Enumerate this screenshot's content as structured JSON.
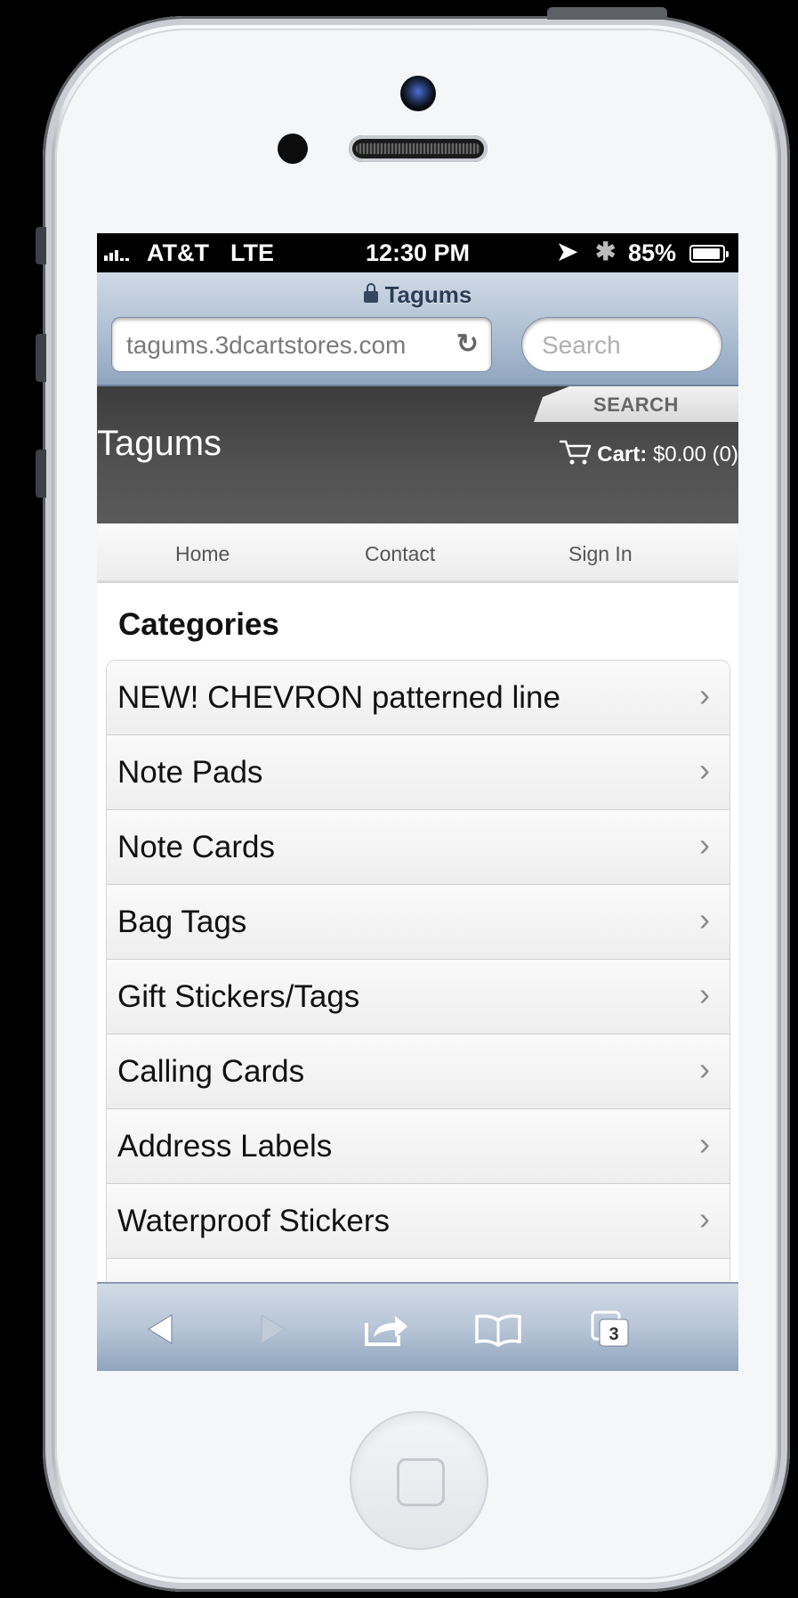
{
  "status": {
    "carrier": "AT&T",
    "network": "LTE",
    "time": "12:30 PM",
    "battery": "85%"
  },
  "browser": {
    "page_title": "Tagums",
    "url": "tagums.3dcartstores.com",
    "search_placeholder": "Search"
  },
  "site": {
    "search_tab": "SEARCH",
    "logo": "Tagums",
    "cart_label": "Cart:",
    "cart_value": "$0.00 (0)"
  },
  "nav": [
    "Home",
    "Contact",
    "Sign In"
  ],
  "categories": {
    "heading": "Categories",
    "items": [
      "NEW! CHEVRON patterned line",
      "Note Pads",
      "Note Cards",
      "Bag Tags",
      "Gift Stickers/Tags",
      "Calling Cards",
      "Address Labels",
      "Waterproof Stickers"
    ]
  },
  "toolbar": {
    "tabs_count": "3"
  }
}
